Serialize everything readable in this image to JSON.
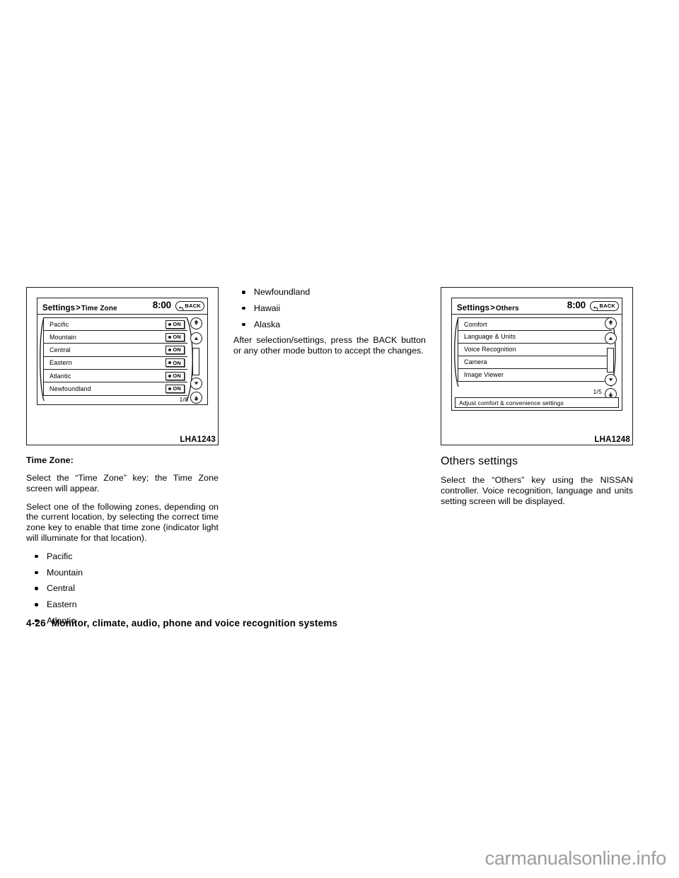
{
  "figure_left": {
    "id_label": "LHA1243",
    "screen": {
      "crumb_root": "Settings",
      "crumb_sep": ">",
      "crumb_leaf": "Time Zone",
      "clock": "8:00",
      "back_label": "BACK",
      "page_count": "1/8",
      "rows": [
        {
          "label": "Pacific",
          "toggle": "ON"
        },
        {
          "label": "Mountain",
          "toggle": "ON"
        },
        {
          "label": "Central",
          "toggle": "ON"
        },
        {
          "label": "Eastern",
          "toggle": "ON"
        },
        {
          "label": "Atlantic",
          "toggle": "ON"
        },
        {
          "label": "Newfoundland",
          "toggle": "ON"
        }
      ]
    }
  },
  "figure_right": {
    "id_label": "LHA1248",
    "screen": {
      "crumb_root": "Settings",
      "crumb_sep": ">",
      "crumb_leaf": "Others",
      "clock": "8:00",
      "back_label": "BACK",
      "page_count": "1/5",
      "rows": [
        {
          "label": "Comfort"
        },
        {
          "label": "Language & Units"
        },
        {
          "label": "Voice Recognition"
        },
        {
          "label": "Camera"
        },
        {
          "label": "Image Viewer"
        }
      ],
      "status_text": "Adjust comfort & convenience settings"
    }
  },
  "column_left": {
    "heading": "Time Zone:",
    "para1": "Select the “Time Zone” key; the Time Zone screen will appear.",
    "para2": "Select one of the following zones, depending on the current location, by selecting the correct time zone key to enable that time zone (indicator light will illuminate for that location).",
    "bullets": [
      "Pacific",
      "Mountain",
      "Central",
      "Eastern",
      "Atlantic"
    ]
  },
  "column_mid": {
    "bullets": [
      "Newfoundland",
      "Hawaii",
      "Alaska"
    ],
    "para1": "After selection/settings, press the BACK button or any other mode button to accept the changes."
  },
  "column_right": {
    "heading": "Others settings",
    "para1": "Select the “Others” key using the NISSAN controller. Voice recognition, language and units setting screen will be displayed."
  },
  "footer": {
    "page_number": "4-26",
    "title": "Monitor, climate, audio, phone and voice recognition systems"
  },
  "watermark": "carmanualsonline.info"
}
